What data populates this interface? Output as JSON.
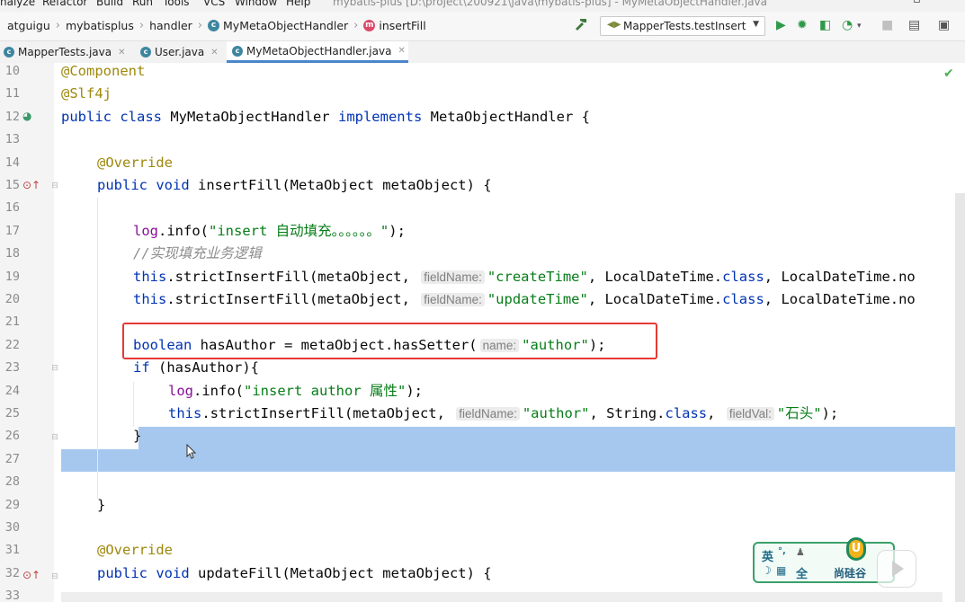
{
  "menu": [
    "nalyze",
    "Refactor",
    "Build",
    "Run",
    "Tools",
    "VCS",
    "Window",
    "Help"
  ],
  "window_title": "mybatis-plus [D:\\project\\200921\\java\\mybatis-plus] - MyMetaObjectHandler.java",
  "breadcrumb": [
    "atguigu",
    "mybatisplus",
    "handler",
    "MyMetaObjectHandler",
    "insertFill"
  ],
  "run_config": "MapperTests.testInsert",
  "tabs": [
    "MapperTests.java",
    "User.java",
    "MyMetaObjectHandler.java"
  ],
  "active_tab": "MyMetaObjectHandler.java",
  "line_numbers": [
    "10",
    "11",
    "12",
    "13",
    "14",
    "15",
    "16",
    "17",
    "18",
    "19",
    "20",
    "21",
    "22",
    "23",
    "24",
    "25",
    "26",
    "27",
    "28",
    "29",
    "30",
    "31",
    "32",
    "33"
  ],
  "code": {
    "l10_ann": "@Component",
    "l11_ann": "@Slf4j",
    "l12_kw1": "public class",
    "l12_name": "MyMetaObjectHandler",
    "l12_kw2": "implements",
    "l12_rest": "MetaObjectHandler {",
    "l14_ann": "@Override",
    "l15_kw": "public void",
    "l15_rest": "insertFill(MetaObject metaObject) {",
    "l17_fld": "log",
    "l17_call": ".info(",
    "l17_str": "\"insert 自动填充。。。。。。\"",
    "l17_end": ");",
    "l18_cmt": "//实现填充业务逻辑",
    "l19_kw": "this",
    "l19_call": ".strictInsertFill(metaObject,",
    "l19_hint": "fieldName:",
    "l19_str": "\"createTime\"",
    "l19_mid": ", LocalDateTime.",
    "l19_kw2": "class",
    "l19_end": ", LocalDateTime.no",
    "l20_kw": "this",
    "l20_call": ".strictInsertFill(metaObject,",
    "l20_hint": "fieldName:",
    "l20_str": "\"updateTime\"",
    "l20_mid": ", LocalDateTime.",
    "l20_kw2": "class",
    "l20_end": ", LocalDateTime.no",
    "l22_kw": "boolean",
    "l22_rest": "hasAuthor = metaObject.hasSetter(",
    "l22_hint": "name:",
    "l22_str": "\"author\"",
    "l22_end": ");",
    "l23_kw": "if",
    "l23_rest": "(hasAuthor){",
    "l24_fld": "log",
    "l24_call": ".info(",
    "l24_str": "\"insert author 属性\"",
    "l24_end": ");",
    "l25_kw": "this",
    "l25_call": ".strictInsertFill(metaObject,",
    "l25_hint": "fieldName:",
    "l25_str": "\"author\"",
    "l25_mid": ", String.",
    "l25_kw2": "class",
    "l25_comma": ",",
    "l25_hint2": "fieldVal:",
    "l25_str2": "\"石头\"",
    "l25_end": ");",
    "l26": "}",
    "l29": "}",
    "l31_ann": "@Override",
    "l32_kw": "public void",
    "l32_rest": "updateFill(MetaObject metaObject) {"
  },
  "ime": {
    "lang": "英",
    "mode": "全",
    "brand": "尚硅谷"
  },
  "colors": {
    "keyword": "#0033b3",
    "annotation": "#9e880d",
    "string": "#067d17",
    "field": "#871094",
    "comment": "#8c8c8c",
    "selection": "#a6c8ee",
    "highlight_box": "#e53935"
  }
}
